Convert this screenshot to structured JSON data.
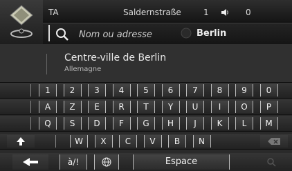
{
  "status": {
    "left_text": "TA",
    "street": "Saldernstraße",
    "volume_level": "1",
    "counter": "0"
  },
  "search": {
    "placeholder": "Nom ou adresse",
    "city": "Berlin"
  },
  "result": {
    "title": "Centre-ville de Berlin",
    "subtitle": "Allemagne"
  },
  "keyboard": {
    "row_numbers": [
      "1",
      "2",
      "3",
      "4",
      "5",
      "6",
      "7",
      "8",
      "9",
      "0"
    ],
    "row_top": [
      "A",
      "Z",
      "E",
      "R",
      "T",
      "Y",
      "U",
      "I",
      "O",
      "P"
    ],
    "row_mid": [
      "Q",
      "S",
      "D",
      "F",
      "G",
      "H",
      "J",
      "K",
      "L",
      "M"
    ],
    "row_bottom": [
      "W",
      "X",
      "C",
      "V",
      "B",
      "N"
    ],
    "symbols_label": "à/!",
    "space_label": "Espace"
  },
  "icons": {
    "app_logo": "map-pin-icon",
    "search": "magnifier-icon",
    "city": "globe-icon",
    "volume": "speaker-icon",
    "shift": "arrow-up-icon",
    "backspace": "backspace-icon",
    "back": "arrow-left-icon",
    "language": "globe-icon",
    "search_key": "magnifier-icon"
  }
}
